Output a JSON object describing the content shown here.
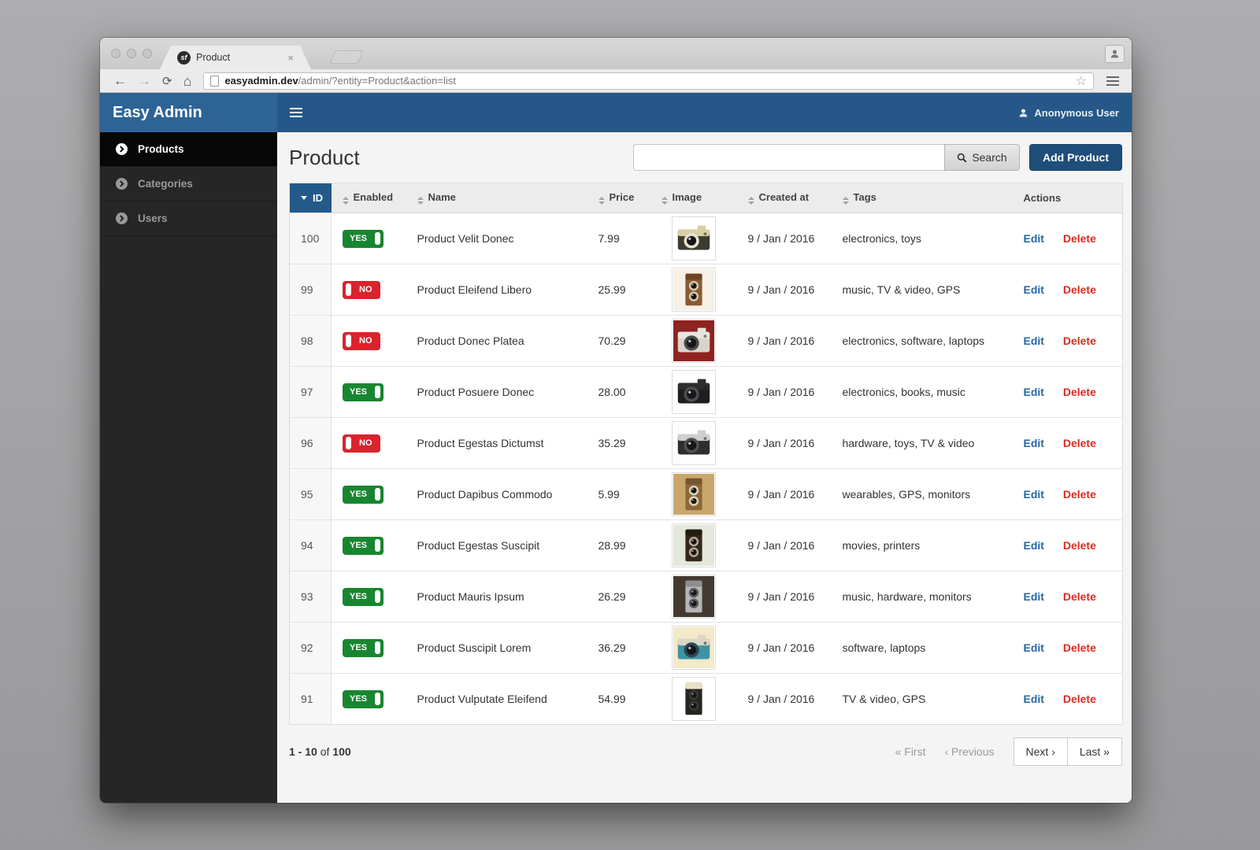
{
  "browser": {
    "tab_title": "Product",
    "favicon_text": "sf",
    "url_host": "easyadmin.dev",
    "url_path": "/admin/?entity=Product&action=list"
  },
  "header": {
    "brand": "Easy Admin",
    "user": "Anonymous User"
  },
  "sidebar": {
    "items": [
      {
        "label": "Products",
        "active": true
      },
      {
        "label": "Categories",
        "active": false
      },
      {
        "label": "Users",
        "active": false
      }
    ]
  },
  "main": {
    "title": "Product",
    "search_value": "",
    "search_button": "Search",
    "add_button": "Add Product"
  },
  "table": {
    "columns": [
      "ID",
      "Enabled",
      "Name",
      "Price",
      "Image",
      "Created at",
      "Tags",
      "Actions"
    ],
    "sorted_column": "ID",
    "sort_direction": "desc",
    "badge_yes": "YES",
    "badge_no": "NO",
    "actions": {
      "edit": "Edit",
      "delete": "Delete"
    },
    "rows": [
      {
        "id": "100",
        "enabled": true,
        "name": "Product Velit Donec",
        "price": "7.99",
        "created": "9 / Jan / 2016",
        "tags": "electronics, toys",
        "img": {
          "t": "cam",
          "bg": "#ffffff",
          "body": "#3c3b31",
          "top": "#d8cfa4",
          "lens": "#e9e4cf"
        }
      },
      {
        "id": "99",
        "enabled": false,
        "name": "Product Eleifend Libero",
        "price": "25.99",
        "created": "9 / Jan / 2016",
        "tags": "music, TV & video, GPS",
        "img": {
          "t": "tlr",
          "bg": "#f6f1e7",
          "body": "#8a5a33",
          "top": "#6e4426",
          "lens": "#d9c9a8"
        }
      },
      {
        "id": "98",
        "enabled": false,
        "name": "Product Donec Platea",
        "price": "70.29",
        "created": "9 / Jan / 2016",
        "tags": "electronics, software, laptops",
        "img": {
          "t": "cam",
          "bg": "#8e2321",
          "body": "#d8d4cc",
          "top": "#e8e5df",
          "lens": "#4a4a4a"
        }
      },
      {
        "id": "97",
        "enabled": true,
        "name": "Product Posuere Donec",
        "price": "28.00",
        "created": "9 / Jan / 2016",
        "tags": "electronics, books, music",
        "img": {
          "t": "cam",
          "bg": "#ffffff",
          "body": "#1e1e1e",
          "top": "#2e2e2e",
          "lens": "#4d4d52"
        }
      },
      {
        "id": "96",
        "enabled": false,
        "name": "Product Egestas Dictumst",
        "price": "35.29",
        "created": "9 / Jan / 2016",
        "tags": "hardware, toys, TV & video",
        "img": {
          "t": "cam",
          "bg": "#fdfdfd",
          "body": "#2e2e2e",
          "top": "#cfcfcf",
          "lens": "#50504e"
        }
      },
      {
        "id": "95",
        "enabled": true,
        "name": "Product Dapibus Commodo",
        "price": "5.99",
        "created": "9 / Jan / 2016",
        "tags": "wearables, GPS, monitors",
        "img": {
          "t": "tlr",
          "bg": "#c9a76c",
          "body": "#8a6a3c",
          "top": "#74562f",
          "lens": "#e4d6b4"
        }
      },
      {
        "id": "94",
        "enabled": true,
        "name": "Product Egestas Suscipit",
        "price": "28.99",
        "created": "9 / Jan / 2016",
        "tags": "movies, printers",
        "img": {
          "t": "tlr",
          "bg": "#e3e8da",
          "body": "#33271c",
          "top": "#241a12",
          "lens": "#b9a98e"
        }
      },
      {
        "id": "93",
        "enabled": true,
        "name": "Product Mauris Ipsum",
        "price": "26.29",
        "created": "9 / Jan / 2016",
        "tags": "music, hardware, monitors",
        "img": {
          "t": "tlr",
          "bg": "#43392e",
          "body": "#b5b5b5",
          "top": "#8e8e8e",
          "lens": "#5b5b5b"
        }
      },
      {
        "id": "92",
        "enabled": true,
        "name": "Product Suscipit Lorem",
        "price": "36.29",
        "created": "9 / Jan / 2016",
        "tags": "software, laptops",
        "img": {
          "t": "cam",
          "bg": "#f4e9c8",
          "body": "#3e93a7",
          "top": "#dcd6c4",
          "lens": "#2b4a52"
        }
      },
      {
        "id": "91",
        "enabled": true,
        "name": "Product Vulputate Eleifend",
        "price": "54.99",
        "created": "9 / Jan / 2016",
        "tags": "TV & video, GPS",
        "img": {
          "t": "tlr",
          "bg": "#ffffff",
          "body": "#26241f",
          "top": "#e8e0c4",
          "lens": "#3a3a3a"
        }
      }
    ]
  },
  "pagination": {
    "range": "1 - 10",
    "of": " of ",
    "total": "100",
    "first": "« First",
    "previous": "‹ Previous",
    "next": "Next ›",
    "last": "Last »"
  },
  "colors": {
    "brand_blue": "#2e6396",
    "header_blue": "#255889",
    "th_blue": "#235a8a",
    "button_blue": "#1f4e7a",
    "link_blue": "#2667a6",
    "success_green": "#18862f",
    "danger_red": "#d9232d",
    "delete_red": "#dd2a1f"
  }
}
